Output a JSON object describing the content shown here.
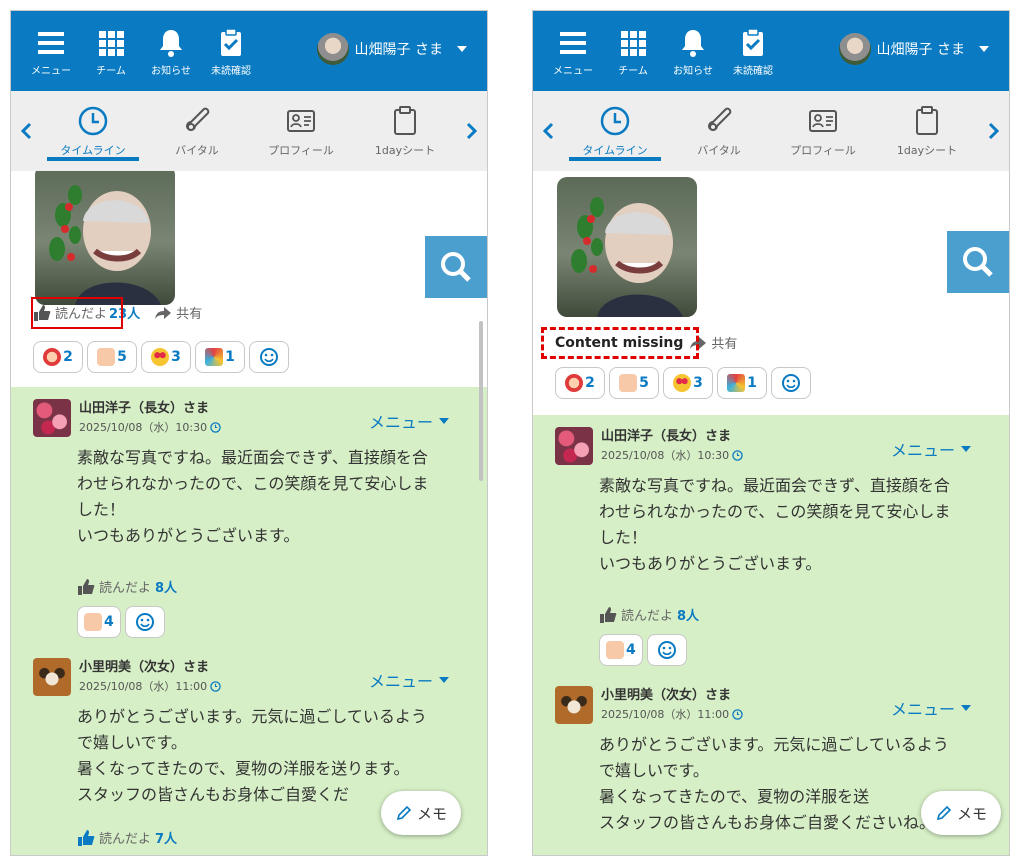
{
  "nav": {
    "menu": "メニュー",
    "team": "チーム",
    "notice": "お知らせ",
    "unread": "未読確認",
    "user_name": "山畑陽子 さま"
  },
  "tabs": [
    {
      "label": "タイムライン",
      "active": true
    },
    {
      "label": "バイタル"
    },
    {
      "label": "プロフィール"
    },
    {
      "label": "1dayシート"
    }
  ],
  "post": {
    "read_label": "読んだよ",
    "read_count": "23人",
    "share_label": "共有",
    "missing_label": "Content missing",
    "reactions": [
      {
        "icon": "face-icon",
        "count": "2"
      },
      {
        "icon": "thumbs-up-icon",
        "count": "5"
      },
      {
        "icon": "heart-eyes-icon",
        "count": "3"
      },
      {
        "icon": "party-popper-icon",
        "count": "1"
      }
    ]
  },
  "comments": [
    {
      "name": "山田洋子（長女）さま",
      "date": "2025/10/08（水）10:30",
      "menu": "メニュー",
      "lines": [
        "素敵な写真ですね。最近面会できず、直接顔を合",
        "わせられなかったので、この笑顔を見て安心しま",
        "した！",
        "いつもありがとうございます。"
      ],
      "read_label": "読んだよ",
      "read_count": "8人",
      "reaction_count": "4"
    },
    {
      "name": "小里明美（次女）さま",
      "date": "2025/10/08（水）11:00",
      "menu": "メニュー",
      "lines_left": [
        "ありがとうございます。元気に過ごしているよう",
        "で嬉しいです。",
        "暑くなってきたので、夏物の洋服を送ります。",
        "スタッフの皆さんもお身体ご自愛くだ"
      ],
      "lines_right": [
        "ありがとうございます。元気に過ごしているよう",
        "で嬉しいです。",
        "暑くなってきたので、夏物の洋服を送",
        "スタッフの皆さんもお身体ご自愛くださいね。"
      ],
      "read_label": "読んだよ",
      "read_count": "7人"
    }
  ],
  "memo_label": "メモ",
  "colors": {
    "brand": "#0a7bc2",
    "comment_bg": "#d6efc6",
    "highlight": "#e00000"
  }
}
